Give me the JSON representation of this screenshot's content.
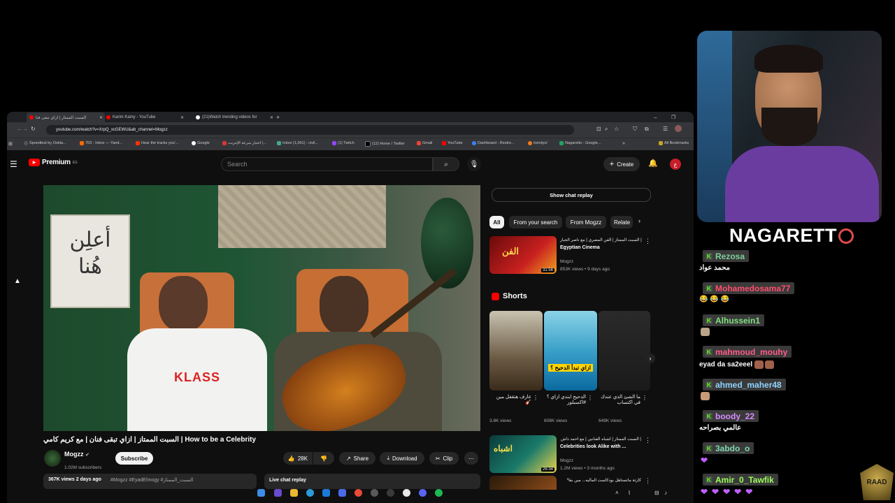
{
  "browser": {
    "tabs": [
      {
        "title": "السبت الممتاز | ازاي تبقى فنا"
      },
      {
        "title": "Karim Kamy - YouTube"
      },
      {
        "title": "(21)Watch trending videos for"
      }
    ],
    "new_tab": "+",
    "url": "youtube.com/watch?v=XrpQ_xcGEWU&ab_channel=Mogzz",
    "bookmarks": [
      "Speedtest by Ookla...",
      "703 - Inbox — Yand...",
      "Hear the tracks you'...",
      "Google",
      "اختبار سرعة الإنترنت |...",
      "Inbox (1,061) - civil...",
      "(1) Twitch",
      "(12) Home / Twitter",
      "Gmail",
      "YouTube",
      "Dashboard - Restre...",
      "trendyol",
      "Nagaretto - Google..."
    ],
    "all_bookmarks": "All Bookmarks"
  },
  "youtube": {
    "logo_text": "Premium",
    "logo_sup": "EG",
    "search_placeholder": "Search",
    "create_label": "Create",
    "video": {
      "title": "السبت الممتاز | ازاي تبقى فنان | مع كريم كامي | How to be a Celebrity",
      "channel": "Mogzz",
      "subscribers": "1.02M subscribers",
      "subscribe_label": "Subscribe",
      "likes": "28K",
      "share_label": "Share",
      "download_label": "Download",
      "clip_label": "Clip",
      "views_date": "367K views  2 days ago",
      "hashtags": "#Mogzz #EyadElmogy #السبت_الممتاز",
      "live_chat_replay": "Live chat replay"
    },
    "show_chat_replay": "Show chat replay",
    "chips": [
      "All",
      "From your search",
      "From Mogzz",
      "Relate"
    ],
    "rec1": {
      "title_ar": "السبت الممتاز | الفن المصري | مع ناصر الجيار |",
      "title_en": "Egyptian Cinema",
      "channel": "Mogzz",
      "meta": "853K views • 9 days ago",
      "duration": "31:56"
    },
    "shorts_title": "Shorts",
    "shorts": [
      {
        "title": "عارف هتقفل مين 🎸",
        "views": "3.8K views"
      },
      {
        "title": "الدحيح ابتدي ازاي ؟ #اكسبلور",
        "views": "608K views"
      },
      {
        "title": "ما الشئ الذي عندك في اكتساب",
        "views": "649K views"
      }
    ],
    "rec2": {
      "title_ar": "السبت الممتاز | اشباه الفنانين | مع احمد داش |",
      "title_en": "Celebrities look Alike with ...",
      "channel": "Mogzz",
      "meta": "1.2M views • 3 months ago",
      "duration": "26:34"
    },
    "rec3": {
      "title": "*كارثة ماتستاهل بودكاست الماليه... مين بقا"
    }
  },
  "stream": {
    "streamer_name": "NAGARETT",
    "chat": [
      {
        "user": "Rezosa",
        "color": "#7fcf9b",
        "message": "محمد عواد"
      },
      {
        "user": "Mohamedosama77",
        "color": "#ff4d6d",
        "message": "😂 😂 😂"
      },
      {
        "user": "Alhussein1",
        "color": "#7fe07f",
        "message": ""
      },
      {
        "user": "mahmoud_mouhy",
        "color": "#ff5a8a",
        "message": "eyad da sa2eeel"
      },
      {
        "user": "ahmed_maher48",
        "color": "#8fd3ff",
        "message": ""
      },
      {
        "user": "boody_22",
        "color": "#d58cff",
        "message": "عالمي بصراحه"
      },
      {
        "user": "3abdo_o",
        "color": "#7fd6b0",
        "message": ""
      },
      {
        "user": "Amir_0_Tawfik",
        "color": "#9cff5a",
        "message": ""
      }
    ],
    "raad_logo": "RAAD"
  },
  "colors": {
    "yt_red": "#ff0000",
    "kick_green": "#53fc18",
    "chat_bg": "#3a3a3a"
  }
}
